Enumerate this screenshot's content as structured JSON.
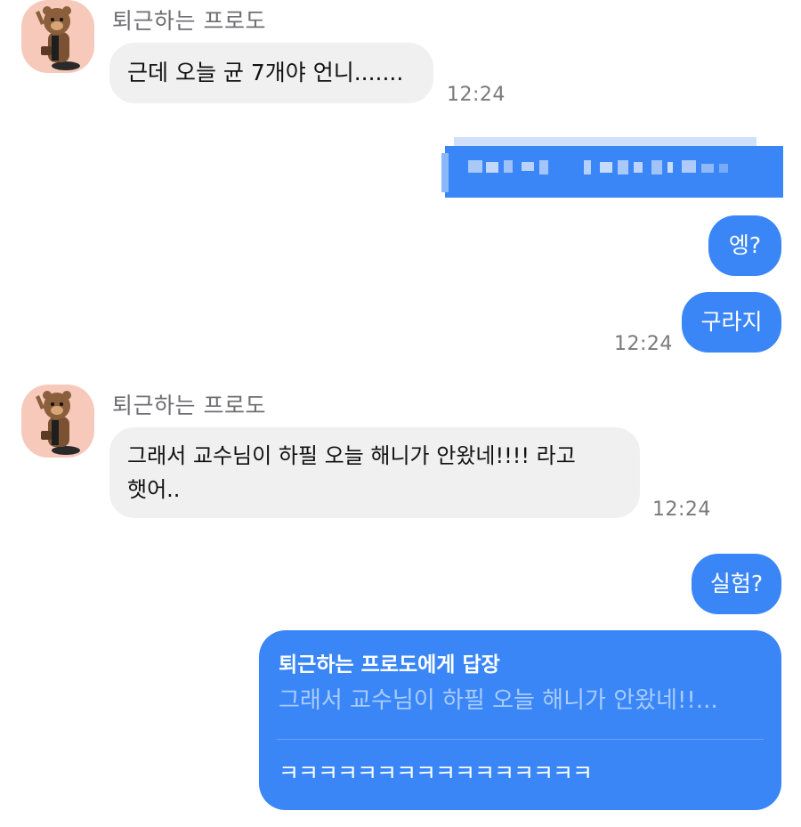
{
  "messages": {
    "m1": {
      "sender": "퇴근하는 프로도",
      "text": "근데 오늘 균 7개야 언니.......",
      "time": "12:24"
    },
    "m2": {
      "text": "엥?"
    },
    "m3": {
      "text": "구라지",
      "time": "12:24"
    },
    "m4": {
      "sender": "퇴근하는 프로도",
      "line1": "그래서 교수님이 하필 오늘 해니가 안왔네!!!! 라고",
      "line2": "햇어..",
      "time": "12:24"
    },
    "m5": {
      "text": "실험?"
    },
    "reply": {
      "header": "퇴근하는 프로도에게 답장",
      "quote": "그래서 교수님이 하필 오늘 해니가 안왔네!!...",
      "text": "ㅋㅋㅋㅋㅋㅋㅋㅋㅋㅋㅋㅋㅋㅋㅋㅋ"
    }
  },
  "colors": {
    "outgoing_bubble": "#3a86f7",
    "incoming_bubble": "#f0f0f0",
    "avatar_background": "#f7c9bb"
  },
  "icons": {
    "avatar": "bear-character-avatar"
  }
}
